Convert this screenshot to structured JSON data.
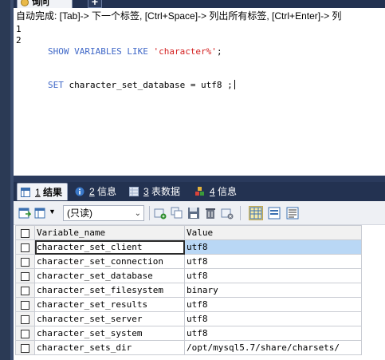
{
  "editor_tab": {
    "title": "询问"
  },
  "editor": {
    "hint": "自动完成: [Tab]-> 下一个标签, [Ctrl+Space]-> 列出所有标签, [Ctrl+Enter]-> 列",
    "line_numbers": [
      "1",
      "2"
    ],
    "line1": {
      "kw1": "SHOW VARIABLES LIKE ",
      "str": "'character%'",
      "tail": ";"
    },
    "line2": {
      "kw1": "SET",
      "rest": " character_set_database = utf8 ;"
    }
  },
  "result_tabs": [
    {
      "num": "1",
      "label": " 结果"
    },
    {
      "num": "2",
      "label": " 信息"
    },
    {
      "num": "3",
      "label": " 表数据"
    },
    {
      "num": "4",
      "label": " 信息"
    }
  ],
  "toolbar": {
    "readonly_value": "(只读)"
  },
  "grid": {
    "columns": [
      "Variable_name",
      "Value"
    ],
    "rows": [
      [
        "character_set_client",
        "utf8"
      ],
      [
        "character_set_connection",
        "utf8"
      ],
      [
        "character_set_database",
        "utf8"
      ],
      [
        "character_set_filesystem",
        "binary"
      ],
      [
        "character_set_results",
        "utf8"
      ],
      [
        "character_set_server",
        "utf8"
      ],
      [
        "character_set_system",
        "utf8"
      ],
      [
        "character_sets_dir",
        "/opt/mysql5.7/share/charsets/"
      ]
    ]
  },
  "colors": {
    "chrome": "#233251",
    "selection": "#b9d7f5",
    "keyword": "#4169c8",
    "string": "#d42222"
  }
}
